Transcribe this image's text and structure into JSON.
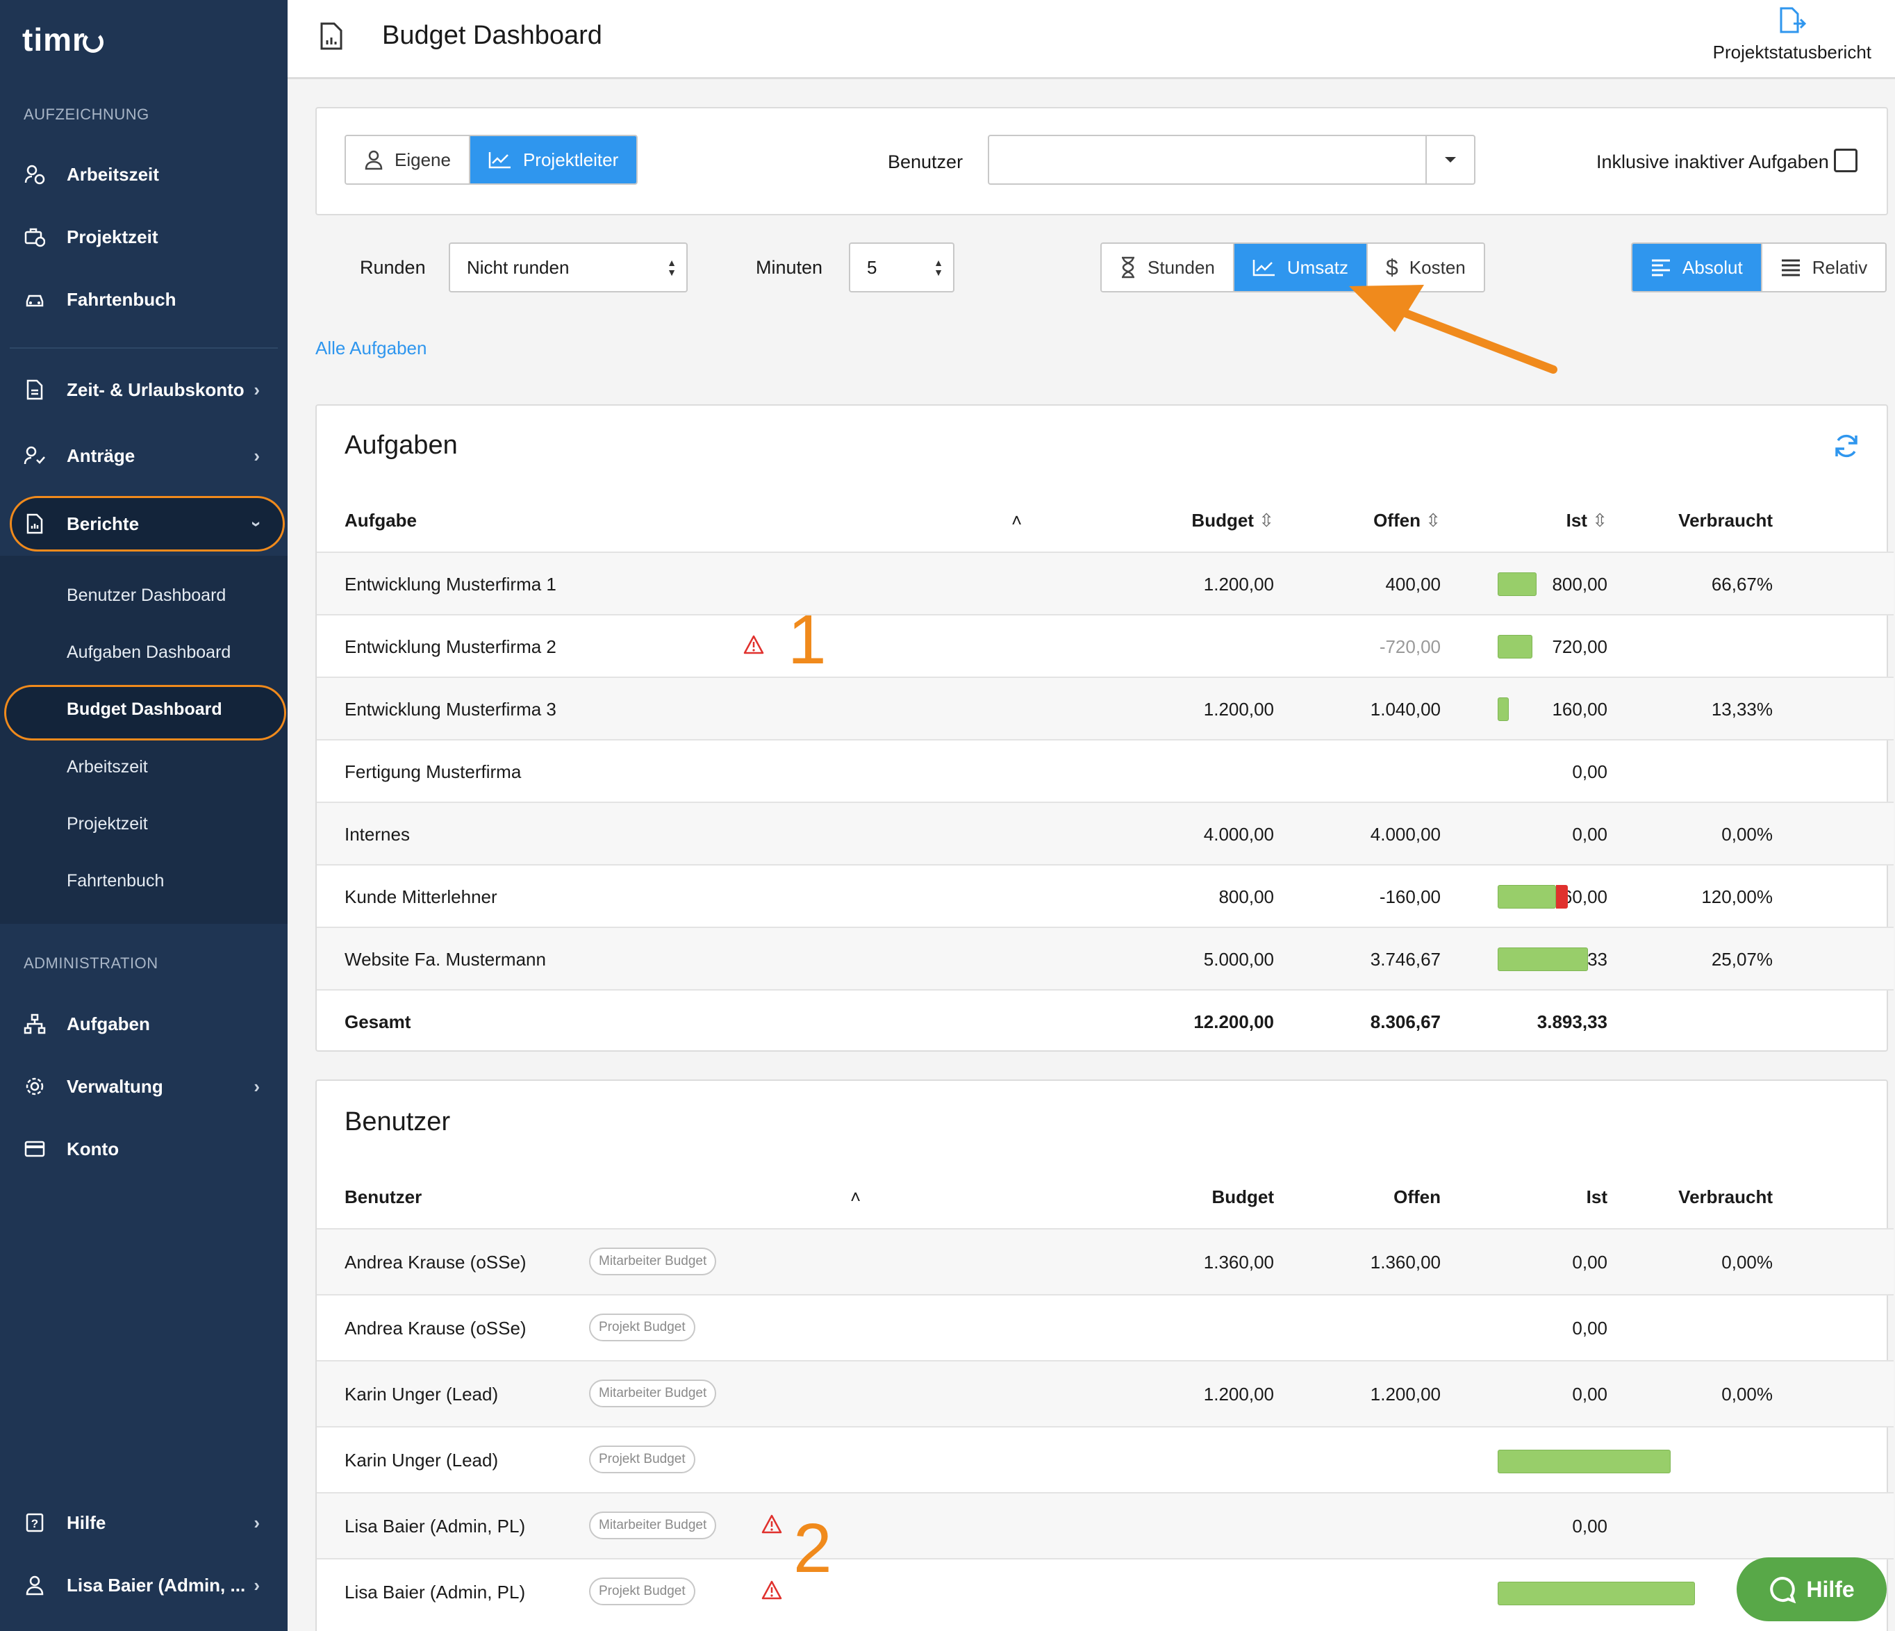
{
  "app": {
    "logo": "timr"
  },
  "sidebar": {
    "section_recording": "AUFZEICHNUNG",
    "recording_items": [
      {
        "label": "Arbeitszeit",
        "icon": "user-clock-icon"
      },
      {
        "label": "Projektzeit",
        "icon": "briefcase-clock-icon"
      },
      {
        "label": "Fahrtenbuch",
        "icon": "car-icon"
      }
    ],
    "middle_items": [
      {
        "label": "Zeit- & Urlaubskonto",
        "icon": "document-icon"
      },
      {
        "label": "Anträge",
        "icon": "user-check-icon"
      },
      {
        "label": "Berichte",
        "icon": "report-icon"
      }
    ],
    "report_sub_items": [
      "Benutzer Dashboard",
      "Aufgaben Dashboard",
      "Budget Dashboard",
      "Arbeitszeit",
      "Projektzeit",
      "Fahrtenbuch"
    ],
    "section_admin": "ADMINISTRATION",
    "admin_items": [
      {
        "label": "Aufgaben",
        "icon": "hierarchy-icon"
      },
      {
        "label": "Verwaltung",
        "icon": "gear-icon"
      },
      {
        "label": "Konto",
        "icon": "credit-card-icon"
      }
    ],
    "bottom_items": [
      {
        "label": "Hilfe",
        "icon": "help-icon"
      },
      {
        "label": "Lisa Baier (Admin, ...",
        "icon": "user-icon"
      }
    ]
  },
  "header": {
    "title": "Budget Dashboard",
    "report_label": "Projektstatusbericht"
  },
  "filters": {
    "mode_own": "Eigene",
    "mode_pl": "Projektleiter",
    "user_label": "Benutzer",
    "user_value": "",
    "inactive_label": "Inklusive inaktiver Aufgaben",
    "inactive_checked": false,
    "round_label": "Runden",
    "round_value": "Nicht runden",
    "minutes_label": "Minuten",
    "minutes_value": "5",
    "metric_hours": "Stunden",
    "metric_revenue": "Umsatz",
    "metric_costs": "Kosten",
    "metric_selected": "Umsatz",
    "view_absolute": "Absolut",
    "view_relative": "Relativ",
    "view_selected": "Absolut"
  },
  "all_tasks_link": "Alle Aufgaben",
  "tasks_table": {
    "title": "Aufgaben",
    "columns": {
      "task": "Aufgabe",
      "budget": "Budget",
      "open": "Offen",
      "actual": "Ist",
      "used": "Verbraucht"
    },
    "rows": [
      {
        "name": "Entwicklung Musterfirma 1",
        "budget": "1.200,00",
        "open": "400,00",
        "actual": "800,00",
        "used": "66,67%",
        "bar": 0.6667,
        "over": 0,
        "warn": false
      },
      {
        "name": "Entwicklung Musterfirma 2",
        "budget": "",
        "open": "-720,00",
        "actual": "720,00",
        "used": "",
        "bar": 0.6,
        "over": 0,
        "warn": true
      },
      {
        "name": "Entwicklung Musterfirma 3",
        "budget": "1.200,00",
        "open": "1.040,00",
        "actual": "160,00",
        "used": "13,33%",
        "bar": 0.1333,
        "over": 0,
        "warn": false
      },
      {
        "name": "Fertigung Musterfirma",
        "budget": "",
        "open": "",
        "actual": "0,00",
        "used": "",
        "bar": 0,
        "over": 0,
        "warn": false
      },
      {
        "name": "Internes",
        "budget": "4.000,00",
        "open": "4.000,00",
        "actual": "0,00",
        "used": "0,00%",
        "bar": 0,
        "over": 0,
        "warn": false
      },
      {
        "name": "Kunde Mitterlehner",
        "budget": "800,00",
        "open": "-160,00",
        "actual": "960,00",
        "used": "120,00%",
        "bar": 1.0,
        "over": 0.2,
        "warn": false
      },
      {
        "name": "Website Fa. Mustermann",
        "budget": "5.000,00",
        "open": "3.746,67",
        "actual": "1.253,33",
        "used": "25,07%",
        "bar": 1.0,
        "over": 0,
        "warn": false
      }
    ],
    "total": {
      "name": "Gesamt",
      "budget": "12.200,00",
      "open": "8.306,67",
      "actual": "3.893,33"
    },
    "annotation": "1"
  },
  "users_table": {
    "title": "Benutzer",
    "columns": {
      "user": "Benutzer",
      "budget": "Budget",
      "open": "Offen",
      "actual": "Ist",
      "used": "Verbraucht"
    },
    "rows": [
      {
        "name": "Andrea Krause (oSSe)",
        "tag": "Mitarbeiter Budget",
        "budget": "1.360,00",
        "open": "1.360,00",
        "actual": "0,00",
        "used": "0,00%",
        "bar": 0,
        "warn": false
      },
      {
        "name": "Andrea Krause (oSSe)",
        "tag": "Projekt Budget",
        "budget": "",
        "open": "",
        "actual": "0,00",
        "used": "",
        "bar": 0,
        "warn": false
      },
      {
        "name": "Karin Unger (Lead)",
        "tag": "Mitarbeiter Budget",
        "budget": "1.200,00",
        "open": "1.200,00",
        "actual": "0,00",
        "used": "0,00%",
        "bar": 0,
        "warn": false
      },
      {
        "name": "Karin Unger (Lead)",
        "tag": "Projekt Budget",
        "budget": "",
        "open": "",
        "actual": "840,00",
        "used": "",
        "bar": 0.875,
        "warn": false
      },
      {
        "name": "Lisa Baier (Admin, PL)",
        "tag": "Mitarbeiter Budget",
        "budget": "",
        "open": "",
        "actual": "0,00",
        "used": "",
        "bar": 0,
        "warn": true
      },
      {
        "name": "Lisa Baier (Admin, PL)",
        "tag": "Projekt Budget",
        "budget": "",
        "open": "",
        "actual": "960,00",
        "used": "",
        "bar": 1.0,
        "warn": true
      }
    ],
    "annotation": "2"
  },
  "help_button": "Hilfe",
  "colors": {
    "sidebar": "#1f3553",
    "accent": "#2f96ee",
    "bar_green": "#98ce6a",
    "bar_red": "#e0312d",
    "annotation_orange": "#f08a1c",
    "help_green": "#58a848"
  }
}
